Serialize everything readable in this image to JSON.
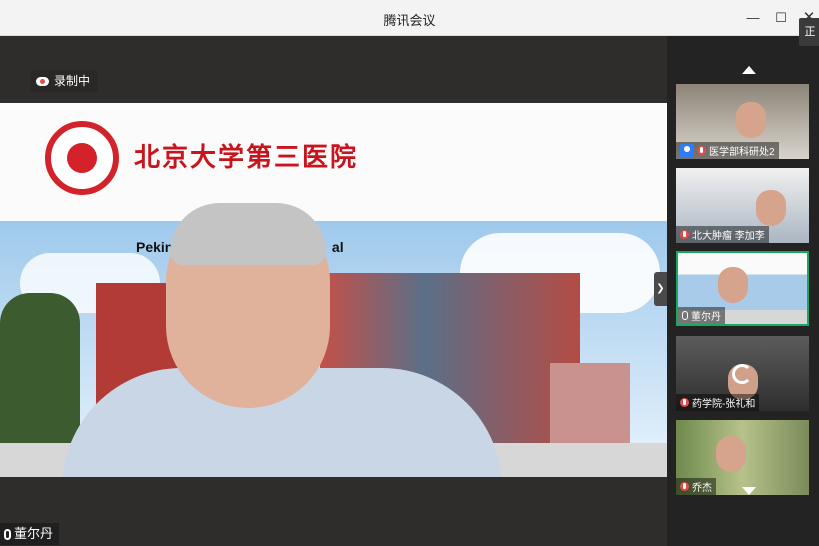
{
  "window": {
    "title": "腾讯会议",
    "minimize_icon": "minimize-icon",
    "maximize_icon": "maximize-icon",
    "close_icon": "close-icon",
    "edge_tag": "正"
  },
  "main": {
    "recording_label": "录制中",
    "hospital_name": "北京大学第三医院",
    "hospital_en": "Peking",
    "hospital_en_tail": "al",
    "speaker_name": "董尔丹",
    "list_icon": "list-icon"
  },
  "sidebar": {
    "tiles": [
      {
        "label": "医学部科研处2",
        "status": "user-icon"
      },
      {
        "label": "北大肿瘤 李加李",
        "status": "muted"
      },
      {
        "label": "董尔丹",
        "status": "mic-on"
      },
      {
        "label": "药学院-张礼和",
        "status": "muted"
      },
      {
        "label": "乔杰",
        "status": "muted"
      }
    ]
  },
  "colors": {
    "active_border": "#1aa860",
    "mute_red": "#e34b4b",
    "brand_red": "#c8151d"
  }
}
